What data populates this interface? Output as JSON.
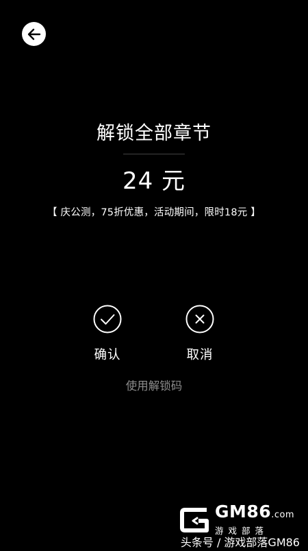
{
  "back": {
    "icon": "arrow-left-icon"
  },
  "title": "解锁全部章节",
  "price": "24 元",
  "promo": "【 庆公测，75折优惠，活动期间，限时18元 】",
  "actions": {
    "confirm": {
      "label": "确认",
      "icon": "checkmark-circle-icon"
    },
    "cancel": {
      "label": "取消",
      "icon": "close-circle-icon"
    }
  },
  "unlock_code_label": "使用解锁码",
  "logo": {
    "main": "GM86",
    "domain": ".com",
    "sub": "游戏部落"
  },
  "watermark": "头条号 / 游戏部落GM86",
  "colors": {
    "background": "#000000",
    "foreground": "#ffffff",
    "muted": "#8c8c8c"
  }
}
